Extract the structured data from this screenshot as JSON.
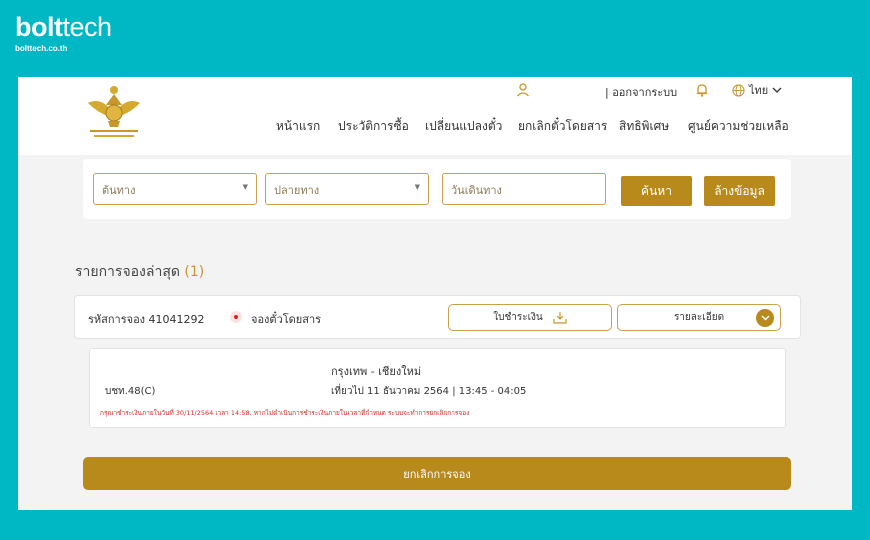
{
  "brand": {
    "logo_bold": "bolt",
    "logo_light": "tech",
    "url": "bolttech.co.th"
  },
  "header": {
    "emblem": "state-railway-emblem",
    "logout_label": "| ออกจากระบบ",
    "language_label": "ไทย",
    "nav": [
      "หน้าแรก",
      "ประวัติการซื้อ",
      "เปลี่ยนแปลงตั๋ว",
      "ยกเลิกตั๋วโดยสาร",
      "สิทธิพิเศษ",
      "ศูนย์ความช่วยเหลือ"
    ]
  },
  "search": {
    "origin_placeholder": "ต้นทาง",
    "destination_placeholder": "ปลายทาง",
    "date_placeholder": "วันเดินทาง",
    "search_label": "ค้นหา",
    "clear_label": "ล้างข้อมูล"
  },
  "recent": {
    "title": "รายการจองล่าสุด",
    "count": "(1)"
  },
  "booking": {
    "code_label": "รหัสการจอง 41041292",
    "status": "จองตั๋วโดยสาร",
    "receipt_label": "ใบชำระเงิน",
    "detail_label": "รายละเอียด",
    "route": "กรุงเทพ - เชียงใหม่",
    "train": "บชท.48(C)",
    "trip": "เที่ยวไป 11 ธันวาคม 2564 | 13:45 - 04:05",
    "warning": "กรุณาชำระเงินภายในวันที่ 30/11/2564 เวลา 14:58. หากไม่ดำเนินการชำระเงินภายในเวลาที่กำหนด ระบบจะทำการยกเลิกการจอง"
  },
  "cancel_label": "ยกเลิกการจอง",
  "colors": {
    "background": "#00b8c4",
    "gold": "#b88a1b",
    "outline": "#c9a14a",
    "warning": "#d0302a"
  }
}
